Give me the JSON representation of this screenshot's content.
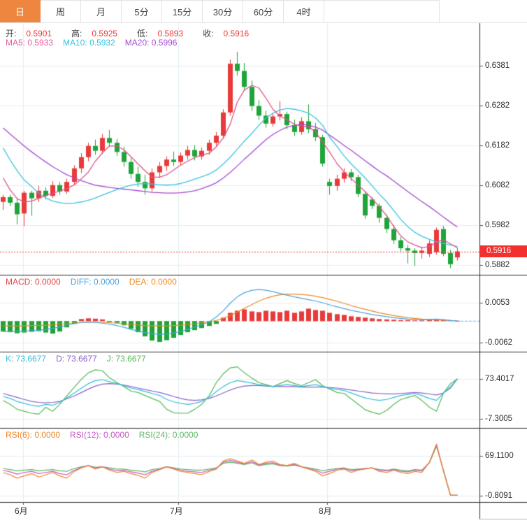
{
  "toolbar": {
    "tabs": [
      {
        "label": "日",
        "active": true
      },
      {
        "label": "周",
        "active": false
      },
      {
        "label": "月",
        "active": false
      },
      {
        "label": "5分",
        "active": false
      },
      {
        "label": "15分",
        "active": false
      },
      {
        "label": "30分",
        "active": false
      },
      {
        "label": "60分",
        "active": false
      },
      {
        "label": "4时",
        "active": false
      }
    ],
    "active_bg": "#ee8640"
  },
  "legends": {
    "ohlc": [
      {
        "label": "开:",
        "value": "0.5901"
      },
      {
        "label": "高:",
        "value": "0.5925"
      },
      {
        "label": "低:",
        "value": "0.5893"
      },
      {
        "label": "收:",
        "value": "0.5916"
      }
    ],
    "ma": [
      {
        "text": "MA5: 0.5933",
        "color": "#e85d9e"
      },
      {
        "text": "MA10: 0.5932",
        "color": "#36c3dd"
      },
      {
        "text": "MA20: 0.5996",
        "color": "#a44bd1"
      }
    ],
    "macd": [
      {
        "text": "MACD: 0.0000",
        "color": "#e34545"
      },
      {
        "text": "DIFF: 0.0000",
        "color": "#4aa4e0"
      },
      {
        "text": "DEA: 0.0000",
        "color": "#f0881f"
      }
    ],
    "kdj": [
      {
        "text": "K: 73.6677",
        "color": "#2fc0d8"
      },
      {
        "text": "D: 73.6677",
        "color": "#8a62c9"
      },
      {
        "text": "J: 73.6677",
        "color": "#56b856"
      }
    ],
    "rsi": [
      {
        "text": "RSI(6): 0.0000",
        "color": "#ef8629"
      },
      {
        "text": "RSI(12): 0.0000",
        "color": "#c55bc5"
      },
      {
        "text": "RSI(24): 0.0000",
        "color": "#5fb766"
      }
    ]
  },
  "axis": {
    "main_ticks": [
      "0.6381",
      "0.6282",
      "0.6182",
      "0.6082",
      "0.5982",
      "0.5882"
    ],
    "last_price_label": "0.5916",
    "macd_ticks": [
      "0.0053",
      "-0.0062"
    ],
    "kdj_ticks": [
      "73.4017",
      "-7.3005"
    ],
    "rsi_ticks": [
      "69.1100",
      "-0.8091"
    ],
    "months": [
      "6月",
      "7月",
      "8月"
    ]
  },
  "colors": {
    "up": "#e83a3a",
    "down": "#1ea438",
    "ma5": "#e0548a",
    "ma10": "#3cc3e2",
    "ma20": "#a44bd1",
    "diff": "#4aa4e0",
    "dea": "#f0881f",
    "k": "#2fc0d8",
    "d": "#8a62c9",
    "j": "#56b856",
    "rsi6": "#ef8629",
    "rsi12": "#c55bc5",
    "rsi24": "#5fb766",
    "grid": "#e4eef4",
    "frame": "#2b2b2b",
    "dotted_price_line": "#f23030",
    "badge_bg": "#f23030"
  },
  "chart_data": {
    "type": "candlestick",
    "title": "",
    "x_axis": {
      "labels": [
        "6月",
        "7月",
        "8月"
      ],
      "tick_x": [
        33,
        255,
        468
      ]
    },
    "price_axis": {
      "ticks": [
        0.6381,
        0.6282,
        0.6182,
        0.6082,
        0.5982,
        0.5882
      ],
      "last_price": 0.5916
    },
    "ohlc_display": {
      "open": 0.5901,
      "high": 0.5925,
      "low": 0.5893,
      "close": 0.5916
    },
    "candles": [
      [
        0.604,
        0.6058,
        0.602,
        0.6052
      ],
      [
        0.6052,
        0.6058,
        0.603,
        0.6038
      ],
      [
        0.6038,
        0.6048,
        0.5984,
        0.6009
      ],
      [
        0.6011,
        0.6068,
        0.5979,
        0.6063
      ],
      [
        0.6063,
        0.6068,
        0.6005,
        0.6049
      ],
      [
        0.6049,
        0.608,
        0.604,
        0.6068
      ],
      [
        0.6068,
        0.6076,
        0.6046,
        0.6055
      ],
      [
        0.6055,
        0.6092,
        0.605,
        0.6082
      ],
      [
        0.6082,
        0.609,
        0.6058,
        0.6066
      ],
      [
        0.6066,
        0.6098,
        0.606,
        0.609
      ],
      [
        0.609,
        0.6132,
        0.6082,
        0.6124
      ],
      [
        0.6124,
        0.6162,
        0.6112,
        0.6152
      ],
      [
        0.6152,
        0.6188,
        0.6142,
        0.618
      ],
      [
        0.618,
        0.6196,
        0.6158,
        0.6168
      ],
      [
        0.6168,
        0.621,
        0.616,
        0.62
      ],
      [
        0.62,
        0.622,
        0.6178,
        0.6188
      ],
      [
        0.6188,
        0.6198,
        0.6155,
        0.6165
      ],
      [
        0.6165,
        0.6178,
        0.6128,
        0.614
      ],
      [
        0.614,
        0.615,
        0.6098,
        0.611
      ],
      [
        0.611,
        0.6128,
        0.6078,
        0.609
      ],
      [
        0.609,
        0.6108,
        0.6058,
        0.6074
      ],
      [
        0.6074,
        0.6124,
        0.6066,
        0.6114
      ],
      [
        0.6114,
        0.614,
        0.61,
        0.613
      ],
      [
        0.613,
        0.6154,
        0.6118,
        0.6146
      ],
      [
        0.6146,
        0.6166,
        0.613,
        0.614
      ],
      [
        0.614,
        0.6164,
        0.6132,
        0.6156
      ],
      [
        0.6156,
        0.618,
        0.6146,
        0.617
      ],
      [
        0.617,
        0.6182,
        0.6144,
        0.6154
      ],
      [
        0.6154,
        0.6176,
        0.6146,
        0.6168
      ],
      [
        0.6168,
        0.6196,
        0.6158,
        0.6188
      ],
      [
        0.6188,
        0.6215,
        0.618,
        0.6206
      ],
      [
        0.6206,
        0.6272,
        0.6198,
        0.6264
      ],
      [
        0.6264,
        0.6396,
        0.6256,
        0.6386
      ],
      [
        0.6386,
        0.6416,
        0.6356,
        0.6368
      ],
      [
        0.6368,
        0.6388,
        0.6318,
        0.6328
      ],
      [
        0.6328,
        0.6344,
        0.6268,
        0.628
      ],
      [
        0.628,
        0.6295,
        0.6245,
        0.6256
      ],
      [
        0.6256,
        0.6268,
        0.6226,
        0.6236
      ],
      [
        0.6236,
        0.6262,
        0.6228,
        0.6254
      ],
      [
        0.6254,
        0.6292,
        0.6244,
        0.626
      ],
      [
        0.626,
        0.6266,
        0.6222,
        0.6232
      ],
      [
        0.6232,
        0.6246,
        0.6205,
        0.6215
      ],
      [
        0.6215,
        0.6252,
        0.6208,
        0.6242
      ],
      [
        0.6242,
        0.6284,
        0.6212,
        0.6222
      ],
      [
        0.6222,
        0.6238,
        0.6192,
        0.6202
      ],
      [
        0.6202,
        0.6208,
        0.6128,
        0.6136
      ],
      [
        0.609,
        0.6098,
        0.6058,
        0.608
      ],
      [
        0.608,
        0.6108,
        0.6068,
        0.6098
      ],
      [
        0.6098,
        0.6124,
        0.6088,
        0.6114
      ],
      [
        0.6114,
        0.6122,
        0.6092,
        0.6102
      ],
      [
        0.6102,
        0.6108,
        0.6052,
        0.606
      ],
      [
        0.606,
        0.6066,
        0.5998,
        0.6006
      ],
      [
        0.6046,
        0.6052,
        0.6022,
        0.603
      ],
      [
        0.603,
        0.6036,
        0.5988,
        0.6
      ],
      [
        0.6,
        0.6008,
        0.5962,
        0.5972
      ],
      [
        0.5972,
        0.5982,
        0.5934,
        0.5944
      ],
      [
        0.5944,
        0.5952,
        0.5916,
        0.5924
      ],
      [
        0.5924,
        0.5932,
        0.5886,
        0.5918
      ],
      [
        0.5918,
        0.5924,
        0.588,
        0.5912
      ],
      [
        0.5912,
        0.5928,
        0.5898,
        0.5918
      ],
      [
        0.591,
        0.5944,
        0.5902,
        0.5936
      ],
      [
        0.5914,
        0.5976,
        0.5908,
        0.597
      ],
      [
        0.5972,
        0.598,
        0.5904,
        0.591
      ],
      [
        0.5912,
        0.592,
        0.5874,
        0.5884
      ],
      [
        0.5901,
        0.5925,
        0.5893,
        0.5916
      ]
    ],
    "ma5": [
      0.61,
      0.607,
      0.6048,
      0.604,
      0.6042,
      0.6049,
      0.6056,
      0.6062,
      0.6067,
      0.6073,
      0.6083,
      0.6098,
      0.6115,
      0.6142,
      0.6163,
      0.618,
      0.618,
      0.617,
      0.6153,
      0.6135,
      0.6118,
      0.6102,
      0.6102,
      0.6108,
      0.612,
      0.6132,
      0.6142,
      0.6151,
      0.6157,
      0.6162,
      0.6178,
      0.62,
      0.6235,
      0.629,
      0.632,
      0.6332,
      0.6325,
      0.63,
      0.6272,
      0.6255,
      0.6246,
      0.6234,
      0.623,
      0.6228,
      0.6215,
      0.619,
      0.6165,
      0.6135,
      0.6115,
      0.6098,
      0.6082,
      0.6066,
      0.6048,
      0.6028,
      0.6005,
      0.5978,
      0.5955,
      0.594,
      0.5932,
      0.5925,
      0.5928,
      0.594,
      0.5945,
      0.5935,
      0.5925
    ],
    "ma10": [
      0.6175,
      0.6145,
      0.6118,
      0.6095,
      0.6078,
      0.6062,
      0.605,
      0.6042,
      0.6038,
      0.6036,
      0.6037,
      0.604,
      0.6044,
      0.605,
      0.6057,
      0.6064,
      0.6071,
      0.6077,
      0.6082,
      0.6085,
      0.6086,
      0.6085,
      0.6083,
      0.6082,
      0.6083,
      0.6086,
      0.6091,
      0.6097,
      0.6103,
      0.611,
      0.612,
      0.6135,
      0.6152,
      0.6172,
      0.6192,
      0.6212,
      0.6232,
      0.625,
      0.6262,
      0.627,
      0.6274,
      0.6272,
      0.6268,
      0.6262,
      0.625,
      0.6232,
      0.6202,
      0.6178,
      0.6155,
      0.6135,
      0.6118,
      0.61,
      0.608,
      0.606,
      0.604,
      0.6018,
      0.5996,
      0.5978,
      0.5964,
      0.5954,
      0.5946,
      0.594,
      0.5936,
      0.5932,
      0.5928
    ],
    "ma20": [
      0.6225,
      0.621,
      0.6195,
      0.618,
      0.6165,
      0.6152,
      0.614,
      0.6128,
      0.6118,
      0.6108,
      0.61,
      0.6093,
      0.6087,
      0.6082,
      0.6079,
      0.6076,
      0.6074,
      0.6072,
      0.607,
      0.6068,
      0.6066,
      0.6064,
      0.6063,
      0.6062,
      0.6062,
      0.6063,
      0.6065,
      0.6068,
      0.6073,
      0.608,
      0.6088,
      0.61,
      0.6114,
      0.613,
      0.6147,
      0.6164,
      0.618,
      0.6196,
      0.6209,
      0.6219,
      0.6227,
      0.6232,
      0.6234,
      0.6232,
      0.6227,
      0.622,
      0.6207,
      0.6194,
      0.6181,
      0.6169,
      0.6156,
      0.6143,
      0.613,
      0.6117,
      0.6105,
      0.6092,
      0.6079,
      0.6066,
      0.6053,
      0.6041,
      0.6028,
      0.6015,
      0.6002,
      0.5989,
      0.5977
    ],
    "macd": {
      "ticks": [
        0.0053,
        -0.0062
      ],
      "hist": [
        -0.003,
        -0.0032,
        -0.0035,
        -0.0033,
        -0.0031,
        -0.0029,
        -0.0033,
        -0.0036,
        -0.003,
        -0.0018,
        -0.0008,
        0.0006,
        0.0008,
        0.0007,
        0.0005,
        -0.0003,
        -0.0005,
        -0.0012,
        -0.0022,
        -0.0032,
        -0.0044,
        -0.0056,
        -0.006,
        -0.0055,
        -0.0048,
        -0.004,
        -0.0032,
        -0.0026,
        -0.002,
        -0.0014,
        -0.0008,
        0.001,
        0.0024,
        0.003,
        0.0034,
        0.0028,
        0.0026,
        0.003,
        0.0028,
        0.0026,
        0.003,
        0.0024,
        0.0028,
        0.0036,
        0.0032,
        0.003,
        0.0024,
        0.002,
        0.0018,
        0.0014,
        0.0012,
        0.001,
        0.0008,
        0.0006,
        0.0005,
        0.0004,
        0.0003,
        0.0003,
        0.0002,
        0.0002,
        0.0004,
        0.0006,
        0.0005,
        0.0002,
        0.0001
      ],
      "diff": [
        -0.003,
        -0.003,
        -0.0029,
        -0.0029,
        -0.0028,
        -0.0026,
        -0.0024,
        -0.0021,
        -0.0017,
        -0.0012,
        -0.0007,
        -0.0004,
        -0.0003,
        -0.0004,
        -0.0006,
        -0.0009,
        -0.0013,
        -0.0018,
        -0.0024,
        -0.0029,
        -0.0033,
        -0.0036,
        -0.0038,
        -0.0037,
        -0.0034,
        -0.003,
        -0.0024,
        -0.0017,
        -0.001,
        -0.0002,
        0.0012,
        0.003,
        0.0052,
        0.007,
        0.0082,
        0.0089,
        0.0091,
        0.0089,
        0.0085,
        0.008,
        0.0075,
        0.007,
        0.0066,
        0.0062,
        0.0058,
        0.0053,
        0.0047,
        0.0041,
        0.0036,
        0.0031,
        0.0027,
        0.0023,
        0.0019,
        0.0016,
        0.0013,
        0.001,
        0.0008,
        0.0006,
        0.0005,
        0.0004,
        0.0005,
        0.0006,
        0.0004,
        0.0002,
        0.0001
      ],
      "dea": [
        -0.0014,
        -0.0014,
        -0.0014,
        -0.0014,
        -0.0013,
        -0.0013,
        -0.0012,
        -0.0011,
        -0.0009,
        -0.0007,
        -0.0005,
        -0.0004,
        -0.0003,
        -0.0003,
        -0.0004,
        -0.0005,
        -0.0006,
        -0.0008,
        -0.001,
        -0.0011,
        -0.0013,
        -0.0014,
        -0.0014,
        -0.0014,
        -0.0013,
        -0.0012,
        -0.001,
        -0.0008,
        -0.0005,
        -0.0002,
        0.0002,
        0.0008,
        0.0016,
        0.0026,
        0.0037,
        0.0048,
        0.0058,
        0.0066,
        0.0072,
        0.0076,
        0.0078,
        0.0078,
        0.0077,
        0.0075,
        0.0072,
        0.0068,
        0.0063,
        0.0057,
        0.0051,
        0.0045,
        0.0039,
        0.0034,
        0.0029,
        0.0024,
        0.002,
        0.0016,
        0.0013,
        0.001,
        0.0008,
        0.0006,
        0.0005,
        0.0004,
        0.0003,
        0.0002,
        0.0001
      ]
    },
    "kdj": {
      "ticks": [
        73.4017,
        -7.3005
      ],
      "k": [
        38,
        34,
        28,
        24,
        20,
        18,
        22,
        20,
        26,
        35,
        45,
        55,
        64,
        70,
        72,
        68,
        64,
        60,
        55,
        52,
        48,
        44,
        40,
        32,
        27,
        24,
        22,
        24,
        28,
        36,
        48,
        58,
        66,
        70,
        68,
        65,
        62,
        60,
        58,
        60,
        62,
        60,
        58,
        60,
        62,
        58,
        55,
        52,
        50,
        45,
        40,
        35,
        32,
        30,
        32,
        36,
        40,
        42,
        44,
        40,
        34,
        30,
        45,
        58,
        73.67
      ],
      "d": [
        44,
        40,
        36,
        32,
        28,
        26,
        25,
        26,
        28,
        33,
        39,
        46,
        53,
        59,
        63,
        64,
        63,
        61,
        58,
        55,
        52,
        49,
        46,
        42,
        38,
        34,
        31,
        30,
        31,
        34,
        39,
        45,
        51,
        56,
        59,
        60,
        60,
        59,
        58,
        58,
        58,
        58,
        57,
        57,
        57,
        57,
        56,
        55,
        53,
        51,
        49,
        47,
        45,
        44,
        43,
        43,
        44,
        45,
        46,
        45,
        43,
        41,
        45,
        55,
        73.67
      ],
      "j": [
        30,
        22,
        12,
        8,
        4,
        2,
        16,
        8,
        22,
        39,
        57,
        73,
        86,
        92,
        90,
        76,
        66,
        58,
        49,
        46,
        40,
        34,
        28,
        12,
        5,
        4,
        4,
        12,
        22,
        40,
        66,
        84,
        96,
        98,
        86,
        75,
        66,
        62,
        58,
        64,
        70,
        64,
        60,
        66,
        72,
        60,
        53,
        46,
        44,
        33,
        22,
        11,
        6,
        2,
        10,
        22,
        32,
        36,
        40,
        30,
        16,
        8,
        45,
        64,
        73.67
      ]
    },
    "rsi": {
      "ticks": [
        69.11,
        -0.8091
      ],
      "r6": [
        40,
        36,
        30,
        34,
        38,
        32,
        36,
        40,
        34,
        30,
        42,
        48,
        52,
        46,
        50,
        44,
        40,
        42,
        38,
        35,
        30,
        40,
        45,
        50,
        46,
        42,
        40,
        38,
        36,
        42,
        46,
        60,
        64,
        60,
        56,
        62,
        54,
        58,
        60,
        54,
        52,
        56,
        50,
        46,
        42,
        34,
        38,
        44,
        46,
        40,
        44,
        46,
        48,
        42,
        40,
        44,
        40,
        38,
        42,
        40,
        58,
        90,
        42,
        0,
        0
      ],
      "r12": [
        44,
        41,
        37,
        40,
        42,
        38,
        40,
        42,
        38,
        36,
        44,
        49,
        52,
        48,
        50,
        46,
        43,
        44,
        41,
        39,
        36,
        42,
        46,
        50,
        47,
        44,
        42,
        41,
        40,
        44,
        47,
        58,
        61,
        58,
        55,
        59,
        53,
        56,
        57,
        53,
        52,
        54,
        50,
        47,
        44,
        39,
        42,
        46,
        47,
        43,
        45,
        47,
        48,
        44,
        43,
        45,
        42,
        41,
        44,
        43,
        58,
        88,
        43,
        0,
        0
      ],
      "r24": [
        47,
        45,
        43,
        44,
        45,
        43,
        44,
        45,
        43,
        42,
        47,
        50,
        52,
        49,
        50,
        48,
        46,
        46,
        44,
        43,
        41,
        45,
        47,
        50,
        48,
        46,
        45,
        44,
        44,
        46,
        48,
        56,
        58,
        56,
        54,
        57,
        52,
        54,
        55,
        52,
        51,
        53,
        50,
        48,
        46,
        43,
        45,
        47,
        48,
        45,
        46,
        47,
        48,
        45,
        44,
        46,
        44,
        43,
        45,
        44,
        57,
        86,
        44,
        0,
        0
      ]
    }
  }
}
